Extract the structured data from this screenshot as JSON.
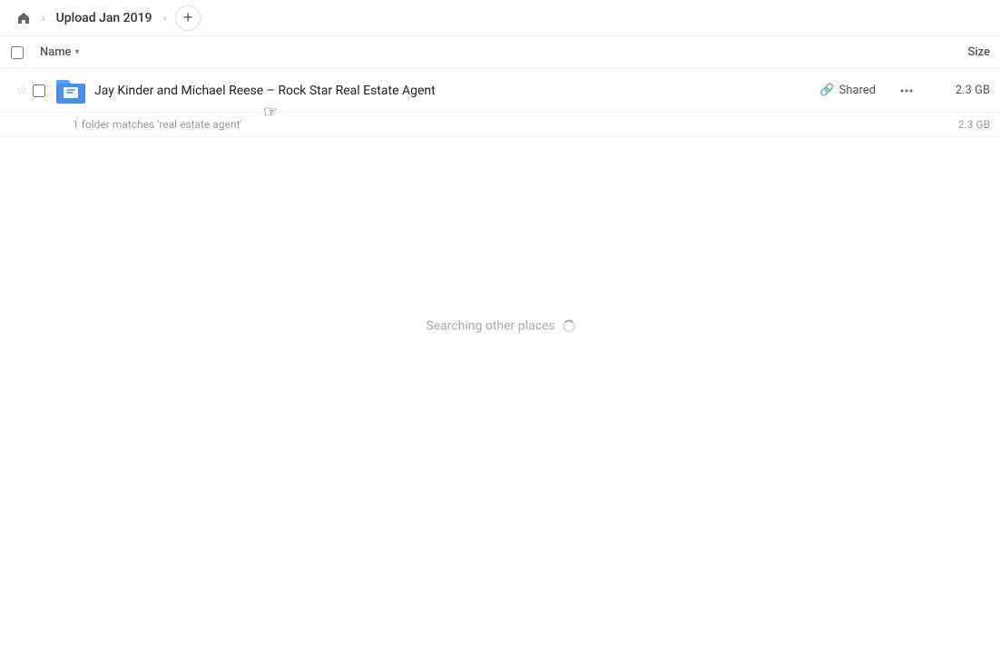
{
  "breadcrumb": {
    "home_icon": "🏠",
    "title": "Upload Jan 2019",
    "chevron": "›",
    "add_label": "+"
  },
  "columns": {
    "checkbox_label": "",
    "name_label": "Name",
    "sort_icon": "▾",
    "size_label": "Size"
  },
  "file_row": {
    "name": "Jay Kinder and Michael Reese – Rock Star Real Estate Agent",
    "shared_label": "Shared",
    "more_icon": "···",
    "size": "2.3 GB"
  },
  "search_result": {
    "text": "1 folder matches 'real estate agent'",
    "size": "2.3 GB"
  },
  "searching": {
    "label": "Searching other places"
  },
  "colors": {
    "accent": "#4a90e2",
    "bg_active": "#f0f4ff",
    "text_muted": "#999999"
  }
}
